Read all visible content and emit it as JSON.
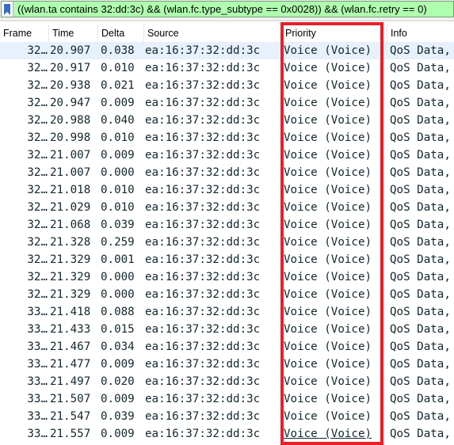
{
  "filter": {
    "icon": "bookmark-icon",
    "value": "((wlan.ta contains 32:dd:3c) && (wlan.fc.type_subtype == 0x0028)) && (wlan.fc.retry == 0)"
  },
  "columns": [
    "Frame",
    "Time",
    "Delta",
    "Source",
    "Priority",
    "Info"
  ],
  "rows": [
    {
      "frame": "32…",
      "time": "20.907",
      "delta": "0.038",
      "source": "ea:16:37:32:dd:3c",
      "priority": "Voice (Voice)",
      "info": "QoS Data,"
    },
    {
      "frame": "32…",
      "time": "20.917",
      "delta": "0.010",
      "source": "ea:16:37:32:dd:3c",
      "priority": "Voice (Voice)",
      "info": "QoS Data,"
    },
    {
      "frame": "32…",
      "time": "20.938",
      "delta": "0.021",
      "source": "ea:16:37:32:dd:3c",
      "priority": "Voice (Voice)",
      "info": "QoS Data,"
    },
    {
      "frame": "32…",
      "time": "20.947",
      "delta": "0.009",
      "source": "ea:16:37:32:dd:3c",
      "priority": "Voice (Voice)",
      "info": "QoS Data,"
    },
    {
      "frame": "32…",
      "time": "20.988",
      "delta": "0.040",
      "source": "ea:16:37:32:dd:3c",
      "priority": "Voice (Voice)",
      "info": "QoS Data,"
    },
    {
      "frame": "32…",
      "time": "20.998",
      "delta": "0.010",
      "source": "ea:16:37:32:dd:3c",
      "priority": "Voice (Voice)",
      "info": "QoS Data,"
    },
    {
      "frame": "32…",
      "time": "21.007",
      "delta": "0.009",
      "source": "ea:16:37:32:dd:3c",
      "priority": "Voice (Voice)",
      "info": "QoS Data,"
    },
    {
      "frame": "32…",
      "time": "21.007",
      "delta": "0.000",
      "source": "ea:16:37:32:dd:3c",
      "priority": "Voice (Voice)",
      "info": "QoS Data,"
    },
    {
      "frame": "32…",
      "time": "21.018",
      "delta": "0.010",
      "source": "ea:16:37:32:dd:3c",
      "priority": "Voice (Voice)",
      "info": "QoS Data,"
    },
    {
      "frame": "32…",
      "time": "21.029",
      "delta": "0.010",
      "source": "ea:16:37:32:dd:3c",
      "priority": "Voice (Voice)",
      "info": "QoS Data,"
    },
    {
      "frame": "32…",
      "time": "21.068",
      "delta": "0.039",
      "source": "ea:16:37:32:dd:3c",
      "priority": "Voice (Voice)",
      "info": "QoS Data,"
    },
    {
      "frame": "32…",
      "time": "21.328",
      "delta": "0.259",
      "source": "ea:16:37:32:dd:3c",
      "priority": "Voice (Voice)",
      "info": "QoS Data,"
    },
    {
      "frame": "32…",
      "time": "21.329",
      "delta": "0.001",
      "source": "ea:16:37:32:dd:3c",
      "priority": "Voice (Voice)",
      "info": "QoS Data,"
    },
    {
      "frame": "32…",
      "time": "21.329",
      "delta": "0.000",
      "source": "ea:16:37:32:dd:3c",
      "priority": "Voice (Voice)",
      "info": "QoS Data,"
    },
    {
      "frame": "32…",
      "time": "21.329",
      "delta": "0.000",
      "source": "ea:16:37:32:dd:3c",
      "priority": "Voice (Voice)",
      "info": "QoS Data,"
    },
    {
      "frame": "33…",
      "time": "21.418",
      "delta": "0.088",
      "source": "ea:16:37:32:dd:3c",
      "priority": "Voice (Voice)",
      "info": "QoS Data,"
    },
    {
      "frame": "33…",
      "time": "21.433",
      "delta": "0.015",
      "source": "ea:16:37:32:dd:3c",
      "priority": "Voice (Voice)",
      "info": "QoS Data,"
    },
    {
      "frame": "33…",
      "time": "21.467",
      "delta": "0.034",
      "source": "ea:16:37:32:dd:3c",
      "priority": "Voice (Voice)",
      "info": "QoS Data,"
    },
    {
      "frame": "33…",
      "time": "21.477",
      "delta": "0.009",
      "source": "ea:16:37:32:dd:3c",
      "priority": "Voice (Voice)",
      "info": "QoS Data,"
    },
    {
      "frame": "33…",
      "time": "21.497",
      "delta": "0.020",
      "source": "ea:16:37:32:dd:3c",
      "priority": "Voice (Voice)",
      "info": "QoS Data,"
    },
    {
      "frame": "33…",
      "time": "21.507",
      "delta": "0.009",
      "source": "ea:16:37:32:dd:3c",
      "priority": "Voice (Voice)",
      "info": "QoS Data,"
    },
    {
      "frame": "33…",
      "time": "21.547",
      "delta": "0.039",
      "source": "ea:16:37:32:dd:3c",
      "priority": "Voice (Voice)",
      "info": "QoS Data,"
    },
    {
      "frame": "33…",
      "time": "21.557",
      "delta": "0.009",
      "source": "ea:16:37:32:dd:3c",
      "priority": "Voice (Voice)",
      "info": "QoS Data,"
    }
  ],
  "colors": {
    "filter_valid_bg": "#afffaf",
    "selected_row_bg": "#e7f1fb",
    "annotation_box": "#e8202a",
    "row_text": "#12272e"
  }
}
